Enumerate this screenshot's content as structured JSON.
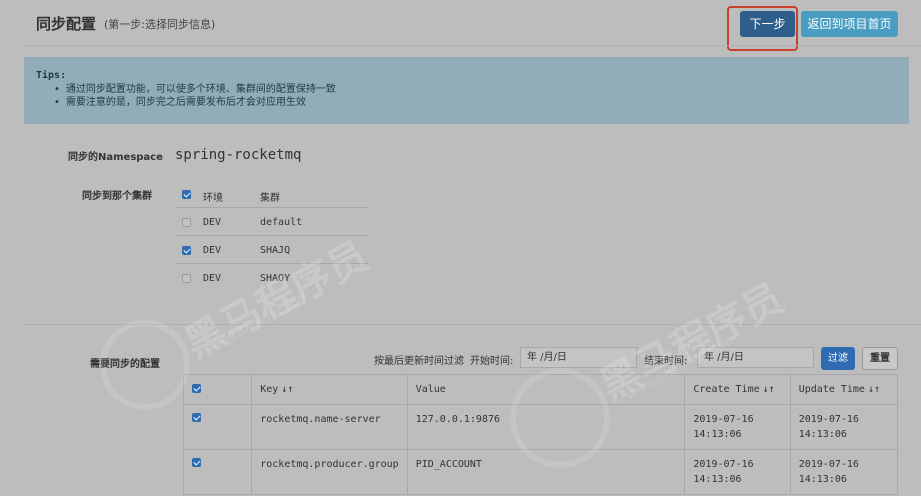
{
  "header": {
    "title": "同步配置",
    "subtitle": "(第一步:选择同步信息)",
    "next_label": "下一步",
    "back_label": "返回到项目首页"
  },
  "tips": {
    "title": "Tips:",
    "items": [
      "通过同步配置功能，可以使多个环境、集群间的配置保持一致",
      "需要注意的是，同步完之后需要发布后才会对应用生效"
    ]
  },
  "namespace": {
    "label": "同步的Namespace",
    "value": "spring-rocketmq"
  },
  "clusters": {
    "label": "同步到那个集群",
    "header": {
      "env": "环境",
      "cluster": "集群",
      "checked": true
    },
    "rows": [
      {
        "env": "DEV",
        "cluster": "default",
        "checked": false
      },
      {
        "env": "DEV",
        "cluster": "SHAJQ",
        "checked": true
      },
      {
        "env": "DEV",
        "cluster": "SHAOY",
        "checked": false
      }
    ]
  },
  "configs": {
    "label": "需要同步的配置",
    "filter": {
      "text": "按最后更新时间过滤",
      "start_label": "开始时间:",
      "start_value": "年 /月/日",
      "end_label": "结束时间:",
      "end_value": "年 /月/日",
      "filter_label": "过滤",
      "reset_label": "重置"
    },
    "columns": {
      "key": "Key",
      "value": "Value",
      "create": "Create Time",
      "update": "Update Time",
      "sort_icon": "sort-icon"
    },
    "rows": [
      {
        "checked": true,
        "key": "rocketmq.name-server",
        "value": "127.0.0.1:9876",
        "create": "2019-07-16 14:13:06",
        "update": "2019-07-16 14:13:06"
      },
      {
        "checked": true,
        "key": "rocketmq.producer.group",
        "value": "PID_ACCOUNT",
        "create": "2019-07-16 14:13:06",
        "update": "2019-07-16 14:13:06"
      }
    ]
  },
  "watermark": {
    "text": "黑马程序员",
    "url": "www.itheima.com"
  },
  "colors": {
    "background": "#bdbdbd",
    "primary": "#2e5f8b",
    "secondary": "#4a9dc2",
    "highlight_border": "#c8412a",
    "tips_bg": "#92adb7"
  }
}
